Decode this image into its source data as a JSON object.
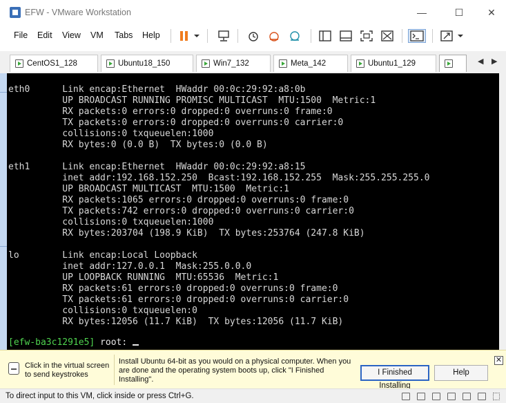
{
  "window": {
    "title": "EFW - VMware Workstation",
    "minimize": "—",
    "maximize": "☐",
    "close": "✕"
  },
  "menu": [
    "File",
    "Edit",
    "View",
    "VM",
    "Tabs",
    "Help"
  ],
  "toolbar_icons": [
    "pause-icon",
    "dropdown-icon",
    "send-keys-icon",
    "snapshot-icon",
    "revert-snapshot-icon",
    "snapshot-manager-icon",
    "sidebar-icon",
    "thumbnail-icon",
    "fullscreen-icon",
    "unity-icon",
    "console-icon",
    "stretch-icon"
  ],
  "tabs": [
    {
      "label": "CentOS1_128"
    },
    {
      "label": "Ubuntu18_150"
    },
    {
      "label": "Win7_132"
    },
    {
      "label": "Meta_142"
    },
    {
      "label": "Ubuntu1_129"
    },
    {
      "label": ""
    }
  ],
  "tab_nav": {
    "left": "◀",
    "right": "▶"
  },
  "console": {
    "lines": [
      "eth0      Link encap:Ethernet  HWaddr 00:0c:29:92:a8:0b",
      "          UP BROADCAST RUNNING PROMISC MULTICAST  MTU:1500  Metric:1",
      "          RX packets:0 errors:0 dropped:0 overruns:0 frame:0",
      "          TX packets:0 errors:0 dropped:0 overruns:0 carrier:0",
      "          collisions:0 txqueuelen:1000",
      "          RX bytes:0 (0.0 B)  TX bytes:0 (0.0 B)",
      "",
      "eth1      Link encap:Ethernet  HWaddr 00:0c:29:92:a8:15",
      "          inet addr:192.168.152.250  Bcast:192.168.152.255  Mask:255.255.255.0",
      "          UP BROADCAST MULTICAST  MTU:1500  Metric:1",
      "          RX packets:1065 errors:0 dropped:0 overruns:0 frame:0",
      "          TX packets:742 errors:0 dropped:0 overruns:0 carrier:0",
      "          collisions:0 txqueuelen:1000",
      "          RX bytes:203704 (198.9 KiB)  TX bytes:253764 (247.8 KiB)",
      "",
      "lo        Link encap:Local Loopback",
      "          inet addr:127.0.0.1  Mask:255.0.0.0",
      "          UP LOOPBACK RUNNING  MTU:65536  Metric:1",
      "          RX packets:61 errors:0 dropped:0 overruns:0 frame:0",
      "          TX packets:61 errors:0 dropped:0 overruns:0 carrier:0",
      "          collisions:0 txqueuelen:0",
      "          RX bytes:12056 (11.7 KiB)  TX bytes:12056 (11.7 KiB)"
    ],
    "prompt_user": "[efw-ba3c1291e5]",
    "prompt_root": " root: "
  },
  "notification": {
    "left_text": "Click in the virtual screen to send keystrokes",
    "message": "Install Ubuntu 64-bit as you would on a physical computer. When you are done and the operating system boots up, click \"I Finished Installing\".",
    "finished_button": "I Finished Installing",
    "help_button": "Help",
    "close": "✕"
  },
  "status": {
    "text": "To direct input to this VM, click inside or press Ctrl+G."
  },
  "colors": {
    "console_bg": "#000000",
    "console_fg": "#d8d8d8",
    "prompt_green": "#4fd44f",
    "pause_orange": "#f07c1e",
    "notify_bg": "#fffcd9"
  }
}
